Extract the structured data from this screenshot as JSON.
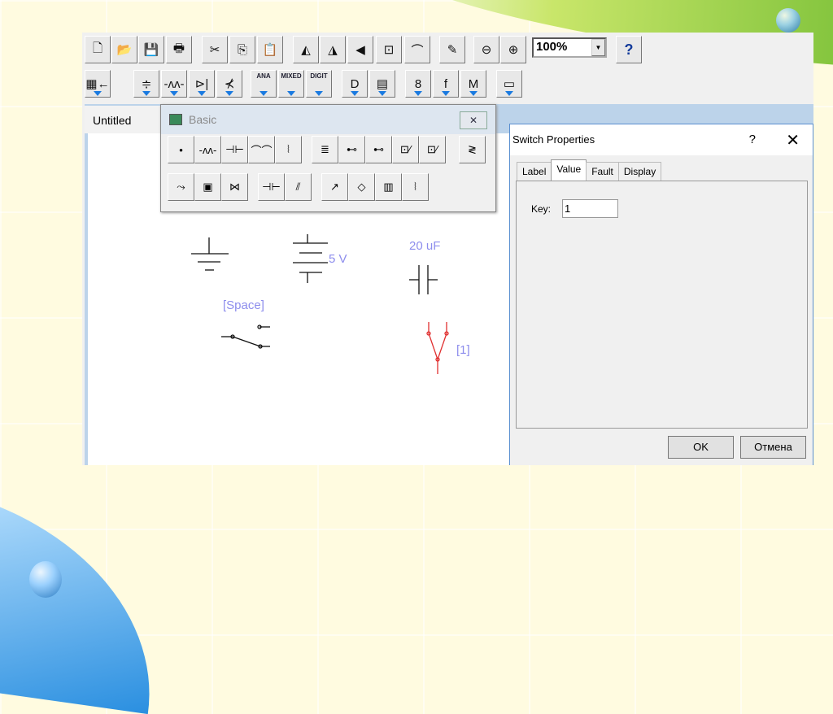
{
  "toolbar1": {
    "icons": [
      "new-file-icon",
      "open-folder-icon",
      "save-icon",
      "print-icon",
      "cut-icon",
      "copy-icon",
      "paste-icon",
      "rotate-icon",
      "flip-horizontal-icon",
      "flip-vertical-icon",
      "component-properties-icon",
      "analysis-graph-icon",
      "edit-pencil-icon",
      "zoom-out-icon",
      "zoom-in-icon"
    ],
    "glyphs": [
      "🗋",
      "📂",
      "💾",
      "🖶",
      "✂",
      "⎘",
      "📋",
      "◭",
      "◮",
      "◀",
      "⊡",
      "⌒",
      "✎",
      "⊖",
      "⊕"
    ],
    "zoom_value": "100%",
    "help_label": "?"
  },
  "toolbar2": {
    "icons": [
      "parts-bin-icon",
      "sources-icon",
      "basic-icon",
      "diodes-icon",
      "transistors-icon",
      "analog-ics-icon",
      "mixed-ics-icon",
      "digital-ics-icon",
      "logic-gates-icon",
      "digital-icon",
      "indicators-icon",
      "controls-icon",
      "miscellaneous-icon",
      "instruments-icon"
    ],
    "glyphs": [
      "▦←",
      "≑",
      "-ʌʌ-",
      "⊳|",
      "⊀",
      "ANA",
      "MIXED",
      "DIGIT",
      "D",
      "▤",
      "8",
      "f",
      "M",
      "▭"
    ]
  },
  "circuit_window": {
    "title": "Untitled"
  },
  "palette": {
    "title": "Basic",
    "close_label": "✕",
    "row1": [
      "•",
      "-ʌʌ-",
      "⊣⊢",
      "⌒⌒",
      "⦚",
      "≣",
      "⊷",
      "⊷",
      "⊡⁄",
      "⊡⁄",
      "≷"
    ],
    "row2": [
      "⤳",
      "▣",
      "⋈",
      "⊣⊢",
      "⫽",
      "↗",
      "◇",
      "▥",
      "⦚"
    ]
  },
  "schematic": {
    "battery_label": "5 V",
    "capacitor_label": "20 uF",
    "switch_label": "[Space]",
    "relay_label": "[1]",
    "relay_color": "#e03030",
    "label_color": "#8d8ded"
  },
  "dialog": {
    "title": "Switch Properties",
    "help": "?",
    "close": "✕",
    "tabs": [
      "Label",
      "Value",
      "Fault",
      "Display"
    ],
    "active_tab": "Value",
    "key_label": "Key:",
    "key_value": "1",
    "ok": "OK",
    "cancel": "Отмена"
  }
}
